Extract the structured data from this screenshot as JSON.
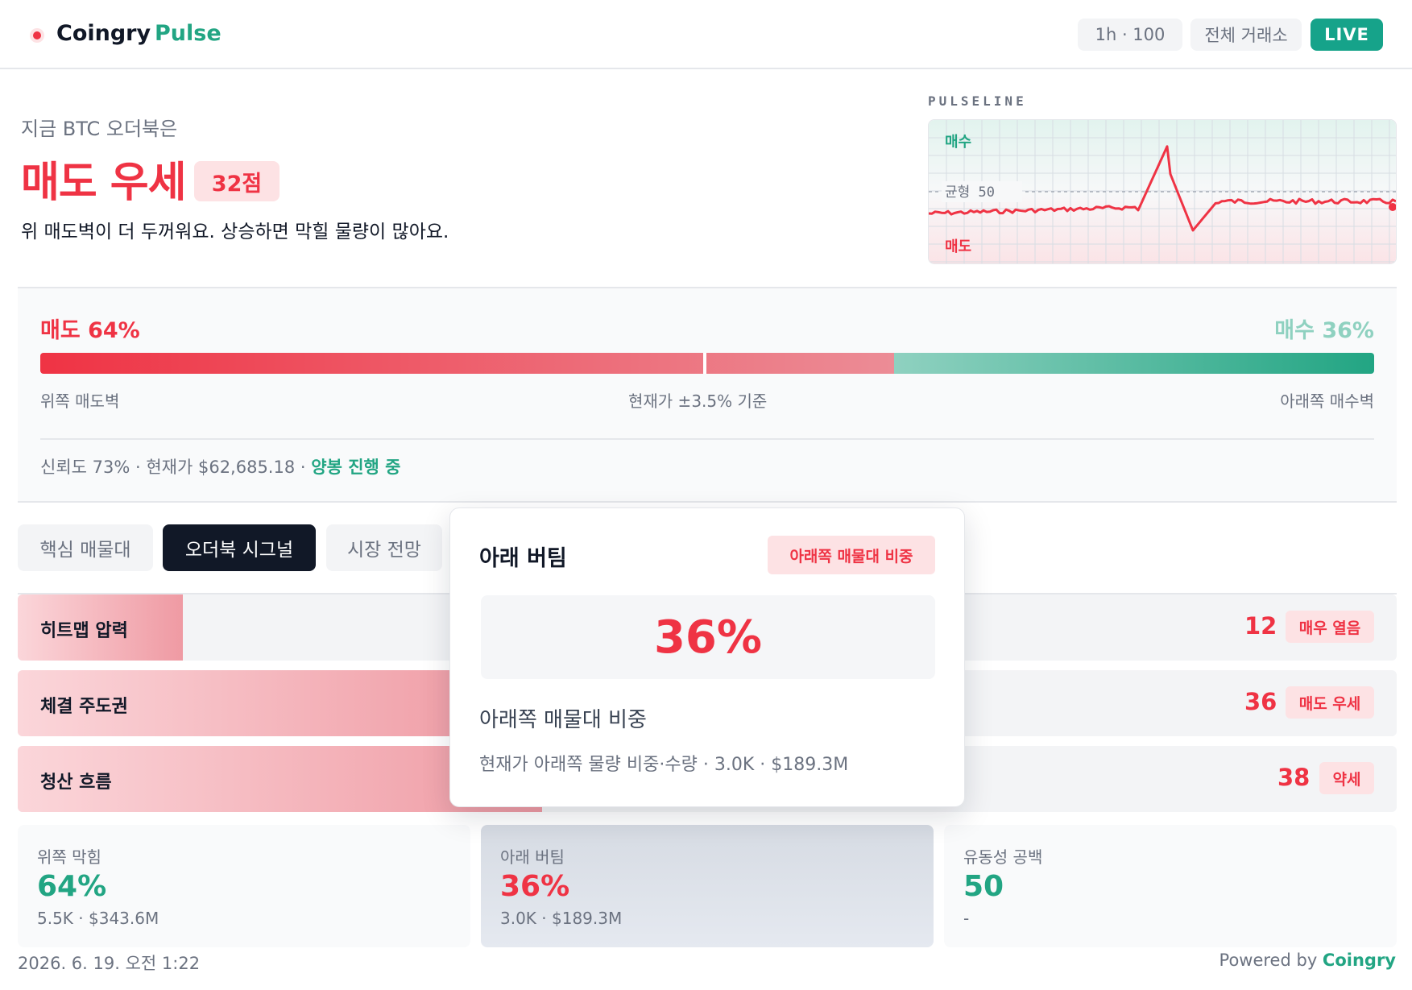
{
  "header": {
    "brand": "Coingry",
    "brand_accent": "Pulse",
    "chips": [
      "1h · 100",
      "전체 거래소"
    ],
    "live": "LIVE"
  },
  "hero": {
    "subtitle": "지금 BTC 오더북은",
    "headline": "매도 우세",
    "score": "32점",
    "description": "위 매도벽이 더 두꺼워요. 상승하면 막힐 물량이 많아요."
  },
  "pulseline": {
    "title": "PULSELINE",
    "top_label": "매수",
    "mid_label": "균형 50",
    "bottom_label": "매도",
    "colors": {
      "buy": "#22a583",
      "sell": "#ef3344"
    }
  },
  "pressure": {
    "sell_label": "매도 64%",
    "buy_label": "매수 36%",
    "sell_share": 0.64,
    "left_caption": "위쪽 매도벽",
    "center_caption": "현재가 ±3.5% 기준",
    "right_caption": "아래쪽 매수벽",
    "confidence_text": "신뢰도 73% · 현재가 $62,685.18 · ",
    "status": "양봉 진행 중"
  },
  "tabs": [
    "핵심 매물대",
    "오더북 시그널",
    "시장 전망"
  ],
  "active_tab": 1,
  "signals": [
    {
      "name": "히트맵 압력",
      "value": "12",
      "tag": "매우 열음",
      "fill": 0.107
    },
    {
      "name": "체결 주도권",
      "value": "36",
      "tag": "매도 우세",
      "fill": 0.36
    },
    {
      "name": "청산 흐름",
      "value": "38",
      "tag": "약세",
      "fill": 0.338
    }
  ],
  "stats": [
    {
      "title": "위쪽 막힘",
      "value": "64%",
      "sub": "5.5K · $343.6M",
      "color": "#22a583"
    },
    {
      "title": "아래 버팀",
      "value": "36%",
      "sub": "3.0K · $189.3M",
      "color": "#ef3344"
    },
    {
      "title": "유동성 공백",
      "value": "50",
      "sub": "-",
      "color": "#22a583"
    }
  ],
  "popover": {
    "title": "아래 버팀",
    "badge": "아래쪽 매물대 비중",
    "value": "36%",
    "subtitle": "아래쪽 매물대 비중",
    "detail": "현재가 아래쪽 물량 비중·수량 · 3.0K · $189.3M"
  },
  "footer": {
    "timestamp": "2026. 6. 19. 오전 1:22",
    "powered": "Powered by ",
    "powered_brand": "Coingry"
  }
}
